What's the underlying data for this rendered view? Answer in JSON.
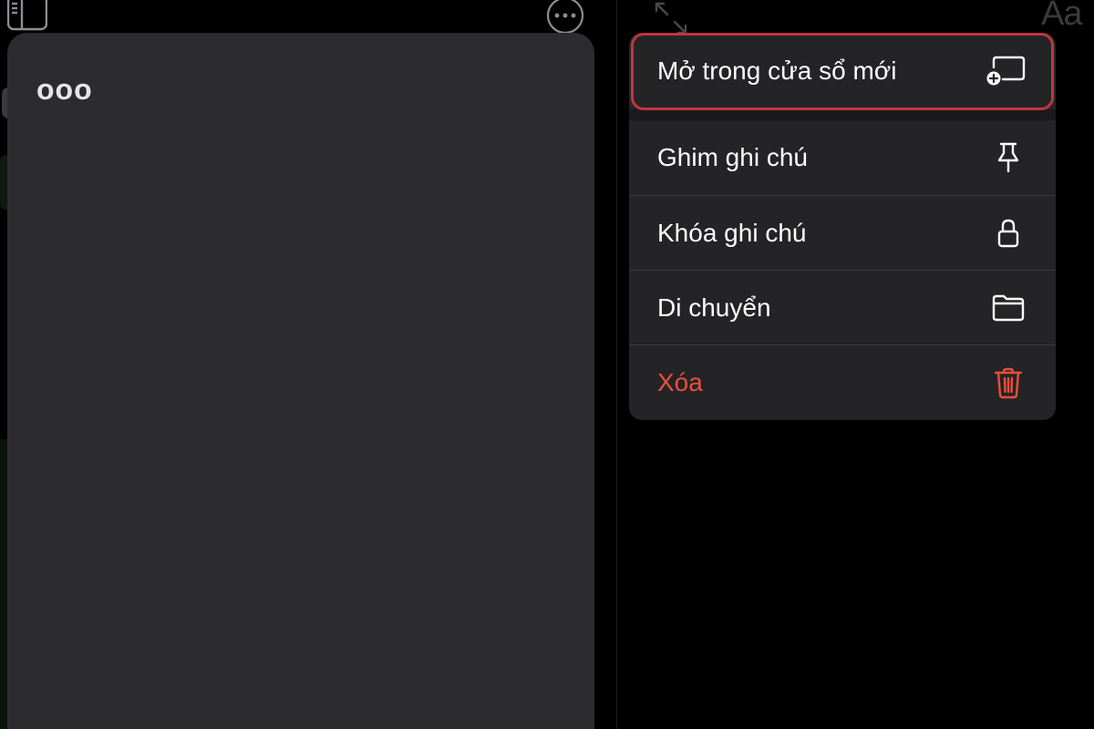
{
  "preview": {
    "title": "ooo"
  },
  "toolbar": {
    "font_button_label": "Aa"
  },
  "context_menu": {
    "items": [
      {
        "label": "Mở trong cửa sổ mới",
        "icon": "new-window-icon",
        "highlighted": true
      },
      {
        "label": "Ghim ghi chú",
        "icon": "pin-icon"
      },
      {
        "label": "Khóa ghi chú",
        "icon": "lock-icon"
      },
      {
        "label": "Di chuyển",
        "icon": "folder-icon"
      },
      {
        "label": "Xóa",
        "icon": "trash-icon",
        "destructive": true
      }
    ]
  },
  "colors": {
    "background": "#000000",
    "card": "#2c2c2e",
    "menu": "#242426",
    "destructive": "#eb4e3d",
    "highlight": "#c0363d"
  }
}
